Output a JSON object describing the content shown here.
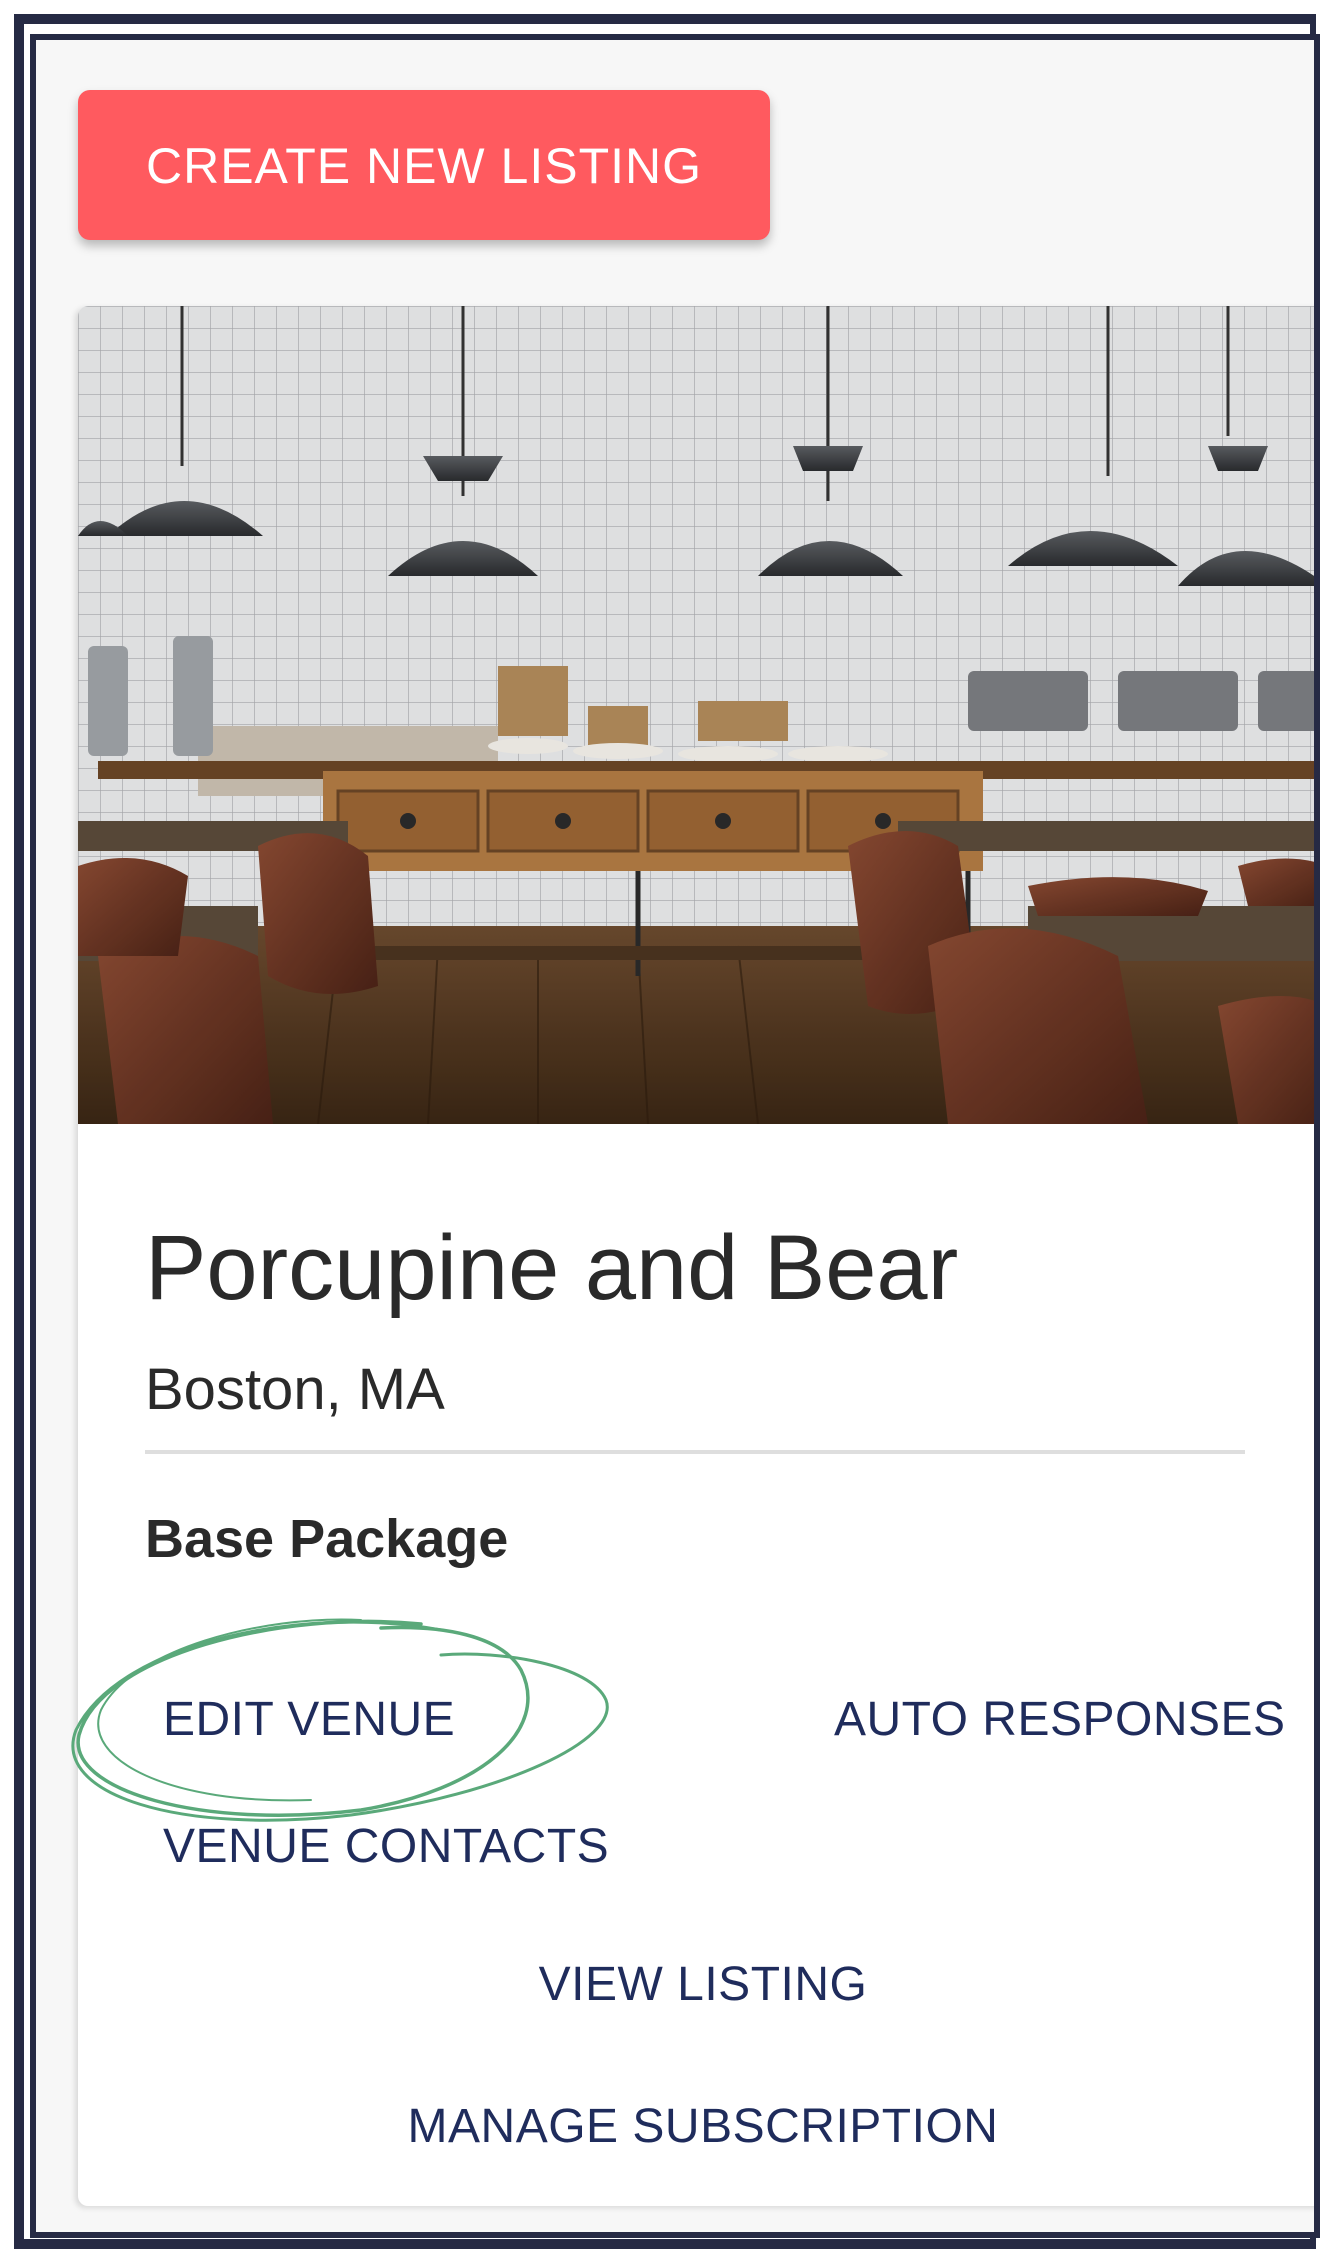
{
  "toolbar": {
    "create_label": "CREATE NEW LISTING"
  },
  "listing": {
    "name": "Porcupine and Bear",
    "location": "Boston, MA",
    "package": "Base Package",
    "actions": {
      "edit_venue": "EDIT VENUE",
      "auto_responses": "AUTO RESPONSES",
      "venue_contacts": "VENUE CONTACTS",
      "view_listing": "VIEW LISTING",
      "manage_subscription": "MANAGE SUBSCRIPTION"
    }
  },
  "colors": {
    "accent": "#ff5a5f",
    "link": "#1f2c5c",
    "frame": "#262a44",
    "annotation": "#5aa97a"
  }
}
